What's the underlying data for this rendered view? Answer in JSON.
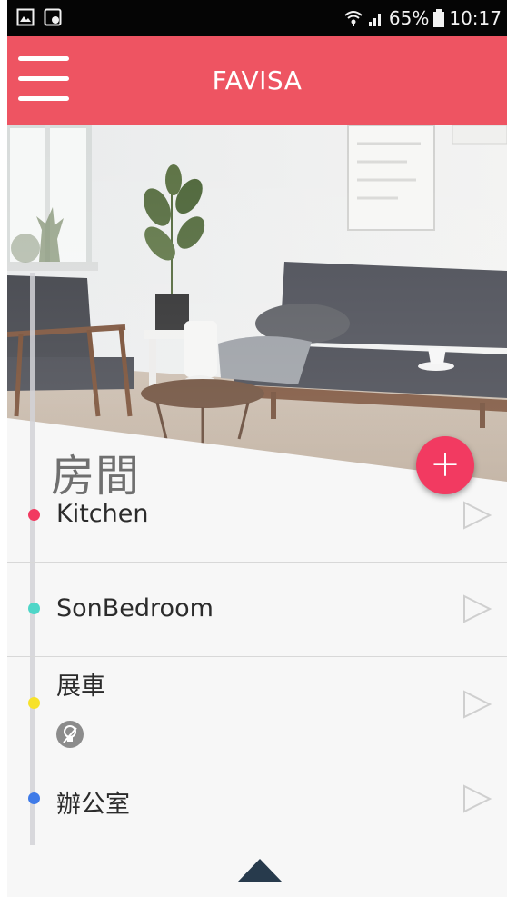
{
  "status_bar": {
    "battery": "65%",
    "time": "10:17",
    "icons": [
      "image-icon",
      "notification-icon",
      "wifi-icon",
      "signal-icon",
      "battery-icon"
    ]
  },
  "app_bar": {
    "title": "FAVISA",
    "menu_icon": "hamburger-menu-icon",
    "color": "#ee5462"
  },
  "section": {
    "title": "房間",
    "add_button_icon": "plus-icon",
    "add_button_color": "#f23a61"
  },
  "rooms": [
    {
      "name": "Kitchen",
      "dot_color": "#f23a61",
      "icon": "play-outline-icon"
    },
    {
      "name": "SonBedroom",
      "dot_color": "#4fd6c8",
      "icon": "play-outline-icon"
    },
    {
      "name": "展車",
      "dot_color": "#f7e22a",
      "icon": "play-outline-icon",
      "status_icon": "lightbulb-icon"
    },
    {
      "name": "辦公室",
      "dot_color": "#3f7be8",
      "icon": "play-outline-icon"
    }
  ],
  "footer": {
    "icon": "triangle-up-icon"
  }
}
